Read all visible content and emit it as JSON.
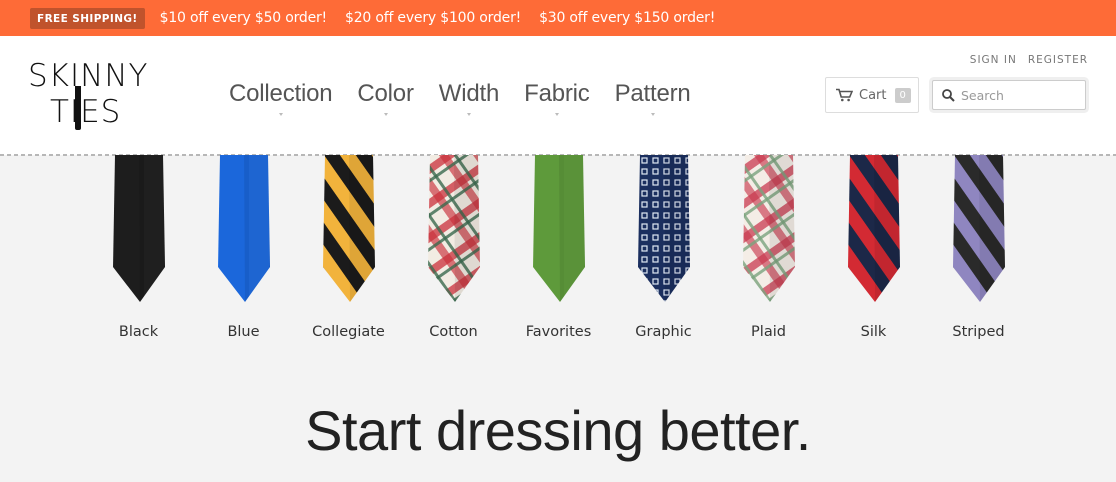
{
  "promo": {
    "badge": "FREE SHIPPING!",
    "offers": [
      "$10 off every $50 order!",
      "$20 off every $100 order!",
      "$30 off every $150 order!"
    ]
  },
  "logo": {
    "line1": "SKINNY",
    "line2": "TIES"
  },
  "nav": [
    "Collection",
    "Color",
    "Width",
    "Fabric",
    "Pattern"
  ],
  "account": {
    "sign_in": "SIGN IN",
    "register": "REGISTER"
  },
  "cart": {
    "label": "Cart",
    "count": "0"
  },
  "search": {
    "placeholder": "Search"
  },
  "ties": [
    {
      "label": "Black",
      "pattern": "solid",
      "colors": [
        "#1d1d1d",
        "#2c2c2c"
      ]
    },
    {
      "label": "Blue",
      "pattern": "solid",
      "colors": [
        "#1b67db",
        "#2b7cf0"
      ]
    },
    {
      "label": "Collegiate",
      "pattern": "stripe",
      "colors": [
        "#f2b33c",
        "#1b1b1b"
      ]
    },
    {
      "label": "Cotton",
      "pattern": "plaid",
      "colors": [
        "#f2ece3",
        "#c9303a",
        "#3b6a4f"
      ]
    },
    {
      "label": "Favorites",
      "pattern": "solid",
      "colors": [
        "#5e9a3b",
        "#6aa845"
      ]
    },
    {
      "label": "Graphic",
      "pattern": "dots",
      "colors": [
        "#1b2f5f",
        "#dfe7f3"
      ]
    },
    {
      "label": "Plaid",
      "pattern": "plaid",
      "colors": [
        "#f4ede6",
        "#c93a50",
        "#7aa47e"
      ]
    },
    {
      "label": "Silk",
      "pattern": "stripe",
      "colors": [
        "#d32a33",
        "#1c2848"
      ]
    },
    {
      "label": "Striped",
      "pattern": "stripe",
      "colors": [
        "#8f86c0",
        "#2a2a2a"
      ]
    }
  ],
  "headline": "Start dressing better."
}
